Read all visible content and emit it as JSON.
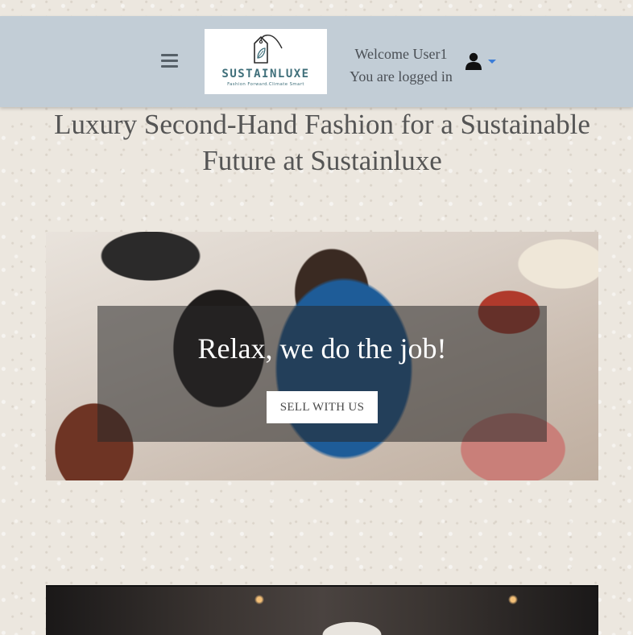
{
  "header": {
    "menu_icon": "hamburger-menu-icon",
    "logo": {
      "brand": "SUSTAINLUXE",
      "tagline": "Fashion Forward.Climate Smart"
    },
    "welcome_text": "Welcome User1",
    "logged_in_text": "You are logged in",
    "user_icon": "user-icon",
    "dropdown_icon": "caret-down-icon"
  },
  "main": {
    "title": "Luxury Second-Hand Fashion for a Sustainable Future at Sustainluxe",
    "hero": {
      "heading": "Relax, we do the job!",
      "button_label": "SELL WITH US"
    }
  },
  "colors": {
    "header_bg": "#c2cdd6",
    "page_bg": "#ece7df",
    "logo_text": "#3f6f7a",
    "dropdown_accent": "#3b7dd8"
  }
}
